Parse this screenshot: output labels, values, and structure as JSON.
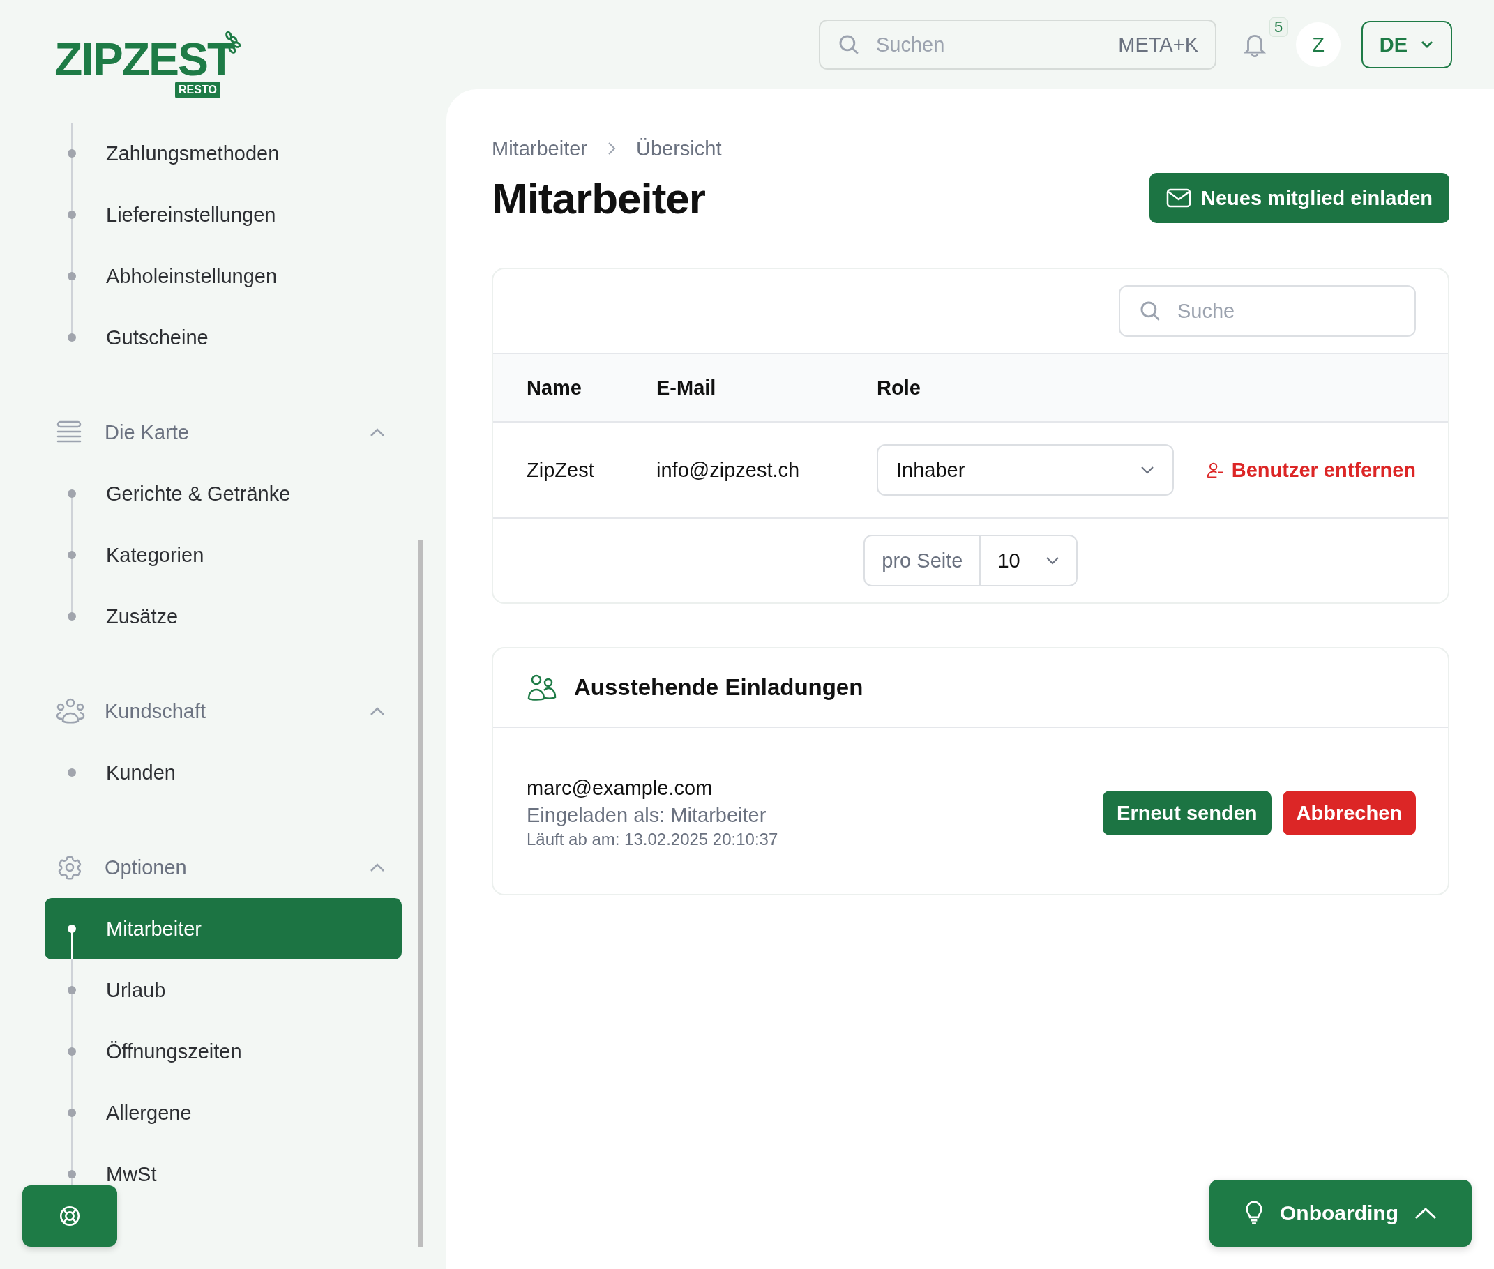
{
  "logo": {
    "name": "ZIPZEST",
    "tag": "RESTO"
  },
  "sidebar": {
    "groups": [
      {
        "items": [
          {
            "label": "Zahlungsmethoden",
            "selected": false
          },
          {
            "label": "Liefereinstellungen",
            "selected": false
          },
          {
            "label": "Abholeinstellungen",
            "selected": false
          },
          {
            "label": "Gutscheine",
            "selected": false
          }
        ]
      },
      {
        "title": "Die Karte",
        "expanded": true,
        "items": [
          {
            "label": "Gerichte & Getränke",
            "selected": false
          },
          {
            "label": "Kategorien",
            "selected": false
          },
          {
            "label": "Zusätze",
            "selected": false
          }
        ]
      },
      {
        "title": "Kundschaft",
        "expanded": true,
        "items": [
          {
            "label": "Kunden",
            "selected": false
          }
        ]
      },
      {
        "title": "Optionen",
        "expanded": true,
        "items": [
          {
            "label": "Mitarbeiter",
            "selected": true
          },
          {
            "label": "Urlaub",
            "selected": false
          },
          {
            "label": "Öffnungszeiten",
            "selected": false
          },
          {
            "label": "Allergene",
            "selected": false
          },
          {
            "label": "MwSt",
            "selected": false
          }
        ]
      }
    ]
  },
  "topbar": {
    "search": {
      "placeholder": "Suchen",
      "shortcut": "META+K"
    },
    "notifications": "5",
    "avatar": "Z",
    "language": "DE"
  },
  "breadcrumb": [
    "Mitarbeiter",
    "Übersicht"
  ],
  "title": "Mitarbeiter",
  "invite_button": "Neues mitglied einladen",
  "members": {
    "search": {
      "placeholder": "Suche"
    },
    "columns": [
      "Name",
      "E-Mail",
      "Role"
    ],
    "rows": [
      {
        "name": "ZipZest",
        "email": "info@zipzest.ch",
        "role": "Inhaber",
        "action": "Benutzer entfernen"
      }
    ],
    "pagination": {
      "label": "pro Seite",
      "value": "10"
    }
  },
  "invitations": {
    "title": "Ausstehende Einladungen",
    "items": [
      {
        "email": "marc@example.com",
        "role": "Eingeladen als: Mitarbeiter",
        "expires": "Läuft ab am: 13.02.2025 20:10:37",
        "resend": "Erneut senden",
        "cancel": "Abbrechen"
      }
    ]
  },
  "onboarding": {
    "label": "Onboarding"
  }
}
